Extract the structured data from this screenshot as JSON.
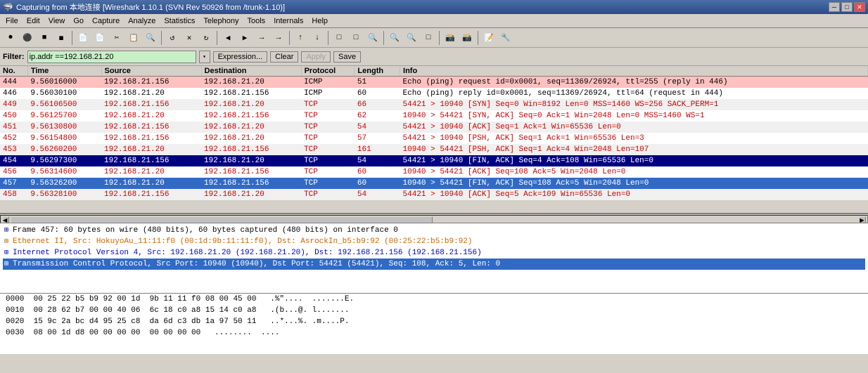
{
  "titlebar": {
    "text": "Capturing from 本地连接  [Wireshark 1.10.1 (SVN Rev 50926 from /trunk-1.10)]",
    "icon": "🦈",
    "btn_min": "─",
    "btn_max": "□",
    "btn_close": "✕"
  },
  "menubar": {
    "items": [
      "File",
      "Edit",
      "View",
      "Go",
      "Capture",
      "Analyze",
      "Statistics",
      "Telephony",
      "Tools",
      "Internals",
      "Help"
    ]
  },
  "toolbar": {
    "buttons": [
      "⏺",
      "⚫",
      "■",
      "◼",
      "📋",
      "📋",
      "✂",
      "📋",
      "🔍",
      "🔄",
      "✕",
      "🔄",
      "⟨",
      "⟩",
      "⟶",
      "⟶",
      "↑",
      "↓",
      "▭",
      "▭",
      "🔍",
      "🔍",
      "🔍",
      "🔲",
      "📷",
      "📷",
      "📝",
      "🔧"
    ]
  },
  "filterbar": {
    "label": "Filter:",
    "value": "ip.addr ==192.168.21.20",
    "placeholder": "ip.addr ==192.168.21.20",
    "expression_btn": "Expression...",
    "clear_btn": "Clear",
    "apply_btn": "Apply",
    "save_btn": "Save"
  },
  "table": {
    "headers": [
      "No.",
      "Time",
      "Source",
      "Destination",
      "Protocol",
      "Length",
      "Info"
    ],
    "rows": [
      {
        "no": "444",
        "time": "9.56016000",
        "src": "192.168.21.156",
        "dst": "192.168.21.20",
        "proto": "ICMP",
        "len": "51",
        "info": "Echo (ping) request   id=0x0001, seq=11369/26924, ttl=255 (reply in 446)",
        "style": "pink"
      },
      {
        "no": "446",
        "time": "9.56030100",
        "src": "192.168.21.20",
        "dst": "192.168.21.156",
        "proto": "ICMP",
        "len": "60",
        "info": "Echo (ping) reply     id=0x0001, seq=11369/26924, ttl=64 (request in 444)",
        "style": "white"
      },
      {
        "no": "449",
        "time": "9.56106500",
        "src": "192.168.21.156",
        "dst": "192.168.21.20",
        "proto": "TCP",
        "len": "66",
        "info": "54421 > 10940 [SYN] Seq=0 Win=8192 Len=0 MSS=1460 WS=256 SACK_PERM=1",
        "style": "red-dark"
      },
      {
        "no": "450",
        "time": "9.56125700",
        "src": "192.168.21.20",
        "dst": "192.168.21.156",
        "proto": "TCP",
        "len": "62",
        "info": "10940 > 54421 [SYN, ACK] Seq=0 Ack=1 Win=2048 Len=0 MSS=1460 WS=1",
        "style": "red"
      },
      {
        "no": "451",
        "time": "9.56130800",
        "src": "192.168.21.156",
        "dst": "192.168.21.20",
        "proto": "TCP",
        "len": "54",
        "info": "54421 > 10940 [ACK] Seq=1 Ack=1 Win=65536 Len=0",
        "style": "red-dark"
      },
      {
        "no": "452",
        "time": "9.56154800",
        "src": "192.168.21.156",
        "dst": "192.168.21.20",
        "proto": "TCP",
        "len": "57",
        "info": "54421 > 10940 [PSH, ACK] Seq=1 Ack=1 Win=65536 Len=3",
        "style": "red"
      },
      {
        "no": "453",
        "time": "9.56260200",
        "src": "192.168.21.20",
        "dst": "192.168.21.156",
        "proto": "TCP",
        "len": "161",
        "info": "10940 > 54421 [PSH, ACK] Seq=1 Ack=4 Win=2048 Len=107",
        "style": "red-dark"
      },
      {
        "no": "454",
        "time": "9.56297300",
        "src": "192.168.21.156",
        "dst": "192.168.21.20",
        "proto": "TCP",
        "len": "54",
        "info": "54421 > 10940 [FIN, ACK] Seq=4 Ack=108 Win=65536 Len=0",
        "style": "blue-dark"
      },
      {
        "no": "456",
        "time": "9.56314600",
        "src": "192.168.21.20",
        "dst": "192.168.21.156",
        "proto": "TCP",
        "len": "60",
        "info": "10940 > 54421 [ACK] Seq=108 Ack=5 Win=2048 Len=0",
        "style": "red"
      },
      {
        "no": "457",
        "time": "9.56326200",
        "src": "192.168.21.20",
        "dst": "192.168.21.156",
        "proto": "TCP",
        "len": "60",
        "info": "10940 > 54421 [FIN, ACK] Seq=108 Ack=5 Win=2048 Len=0",
        "style": "selected"
      },
      {
        "no": "458",
        "time": "9.56328100",
        "src": "192.168.21.156",
        "dst": "192.168.21.20",
        "proto": "TCP",
        "len": "54",
        "info": "54421 > 10940 [ACK] Seq=5 Ack=109 Win=65536 Len=0",
        "style": "red-dark"
      }
    ]
  },
  "details": [
    {
      "text": "Frame 457: 60 bytes on wire (480 bits), 60 bytes captured (480 bits) on interface 0",
      "style": "normal",
      "selected": false
    },
    {
      "text": "Ethernet II, Src: HokuyoAu_11:11:f0 (00:1d:9b:11:11:f0), Dst: AsrockIn_b5:b9:92 (00:25:22:b5:b9:92)",
      "style": "orange",
      "selected": false
    },
    {
      "text": "Internet Protocol Version 4, Src: 192.168.21.20 (192.168.21.20), Dst: 192.168.21.156 (192.168.21.156)",
      "style": "blue",
      "selected": false
    },
    {
      "text": "Transmission Control Protocol, Src Port: 10940 (10940), Dst Port: 54421 (54421), Seq: 108, Ack: 5, Len: 0",
      "style": "selected",
      "selected": true
    }
  ],
  "hex": {
    "rows": [
      {
        "offset": "0000",
        "hex": "00 25 22 b5 b9 92 00 1d  9b 11 11 f0 08 00 45 00",
        "ascii": ".%\"....  .......E."
      },
      {
        "offset": "0010",
        "hex": "00 28 62 b7 00 00 40 06  6c 18 c0 a8 15 14 c0 a8",
        "ascii": ".(b...@. l......."
      },
      {
        "offset": "0020",
        "hex": "15 9c 2a bc d4 95 25 c8  da 6d c3 db 1a 97 50 11",
        "ascii": "..*...%. .m....P."
      },
      {
        "offset": "0030",
        "hex": "08 00 1d d8 00 00 00 00  00 00 00 00",
        "ascii": "........  ...."
      }
    ]
  }
}
